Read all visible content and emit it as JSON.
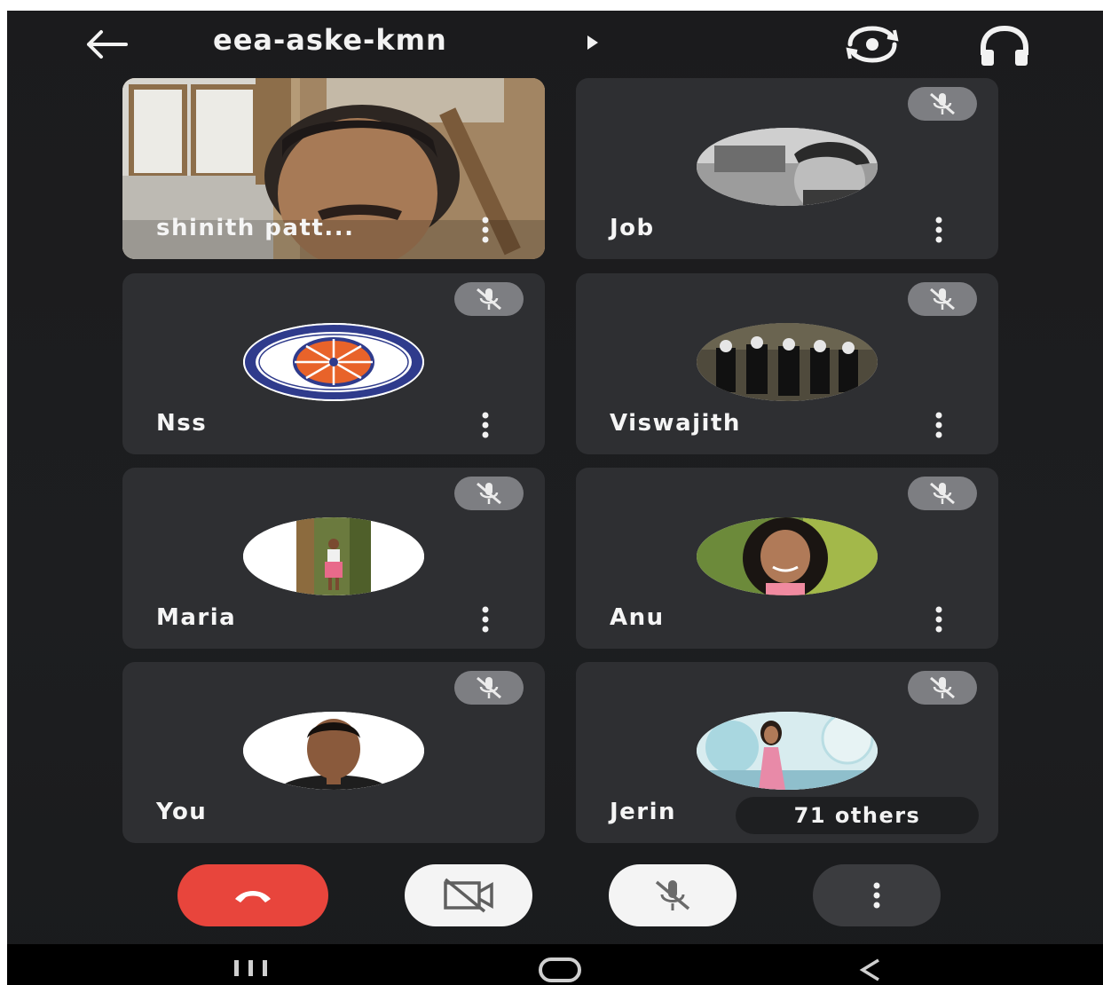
{
  "header": {
    "title": "eea-aske-kmn",
    "back_icon": "arrow-left-icon",
    "chevron_icon": "play-arrow-icon",
    "switch_camera_icon": "switch-camera-icon",
    "audio_output_icon": "headphones-icon"
  },
  "participants": [
    {
      "name": "shinith patt...",
      "video_on": true,
      "muted": false
    },
    {
      "name": "Job",
      "video_on": false,
      "muted": true
    },
    {
      "name": "Nss",
      "video_on": false,
      "muted": true
    },
    {
      "name": "Viswajith",
      "video_on": false,
      "muted": true
    },
    {
      "name": "Maria",
      "video_on": false,
      "muted": true
    },
    {
      "name": "Anu",
      "video_on": false,
      "muted": true
    },
    {
      "name": "You",
      "video_on": false,
      "muted": true
    },
    {
      "name": "Jerin",
      "video_on": false,
      "muted": true
    }
  ],
  "others_chip": "71 others",
  "controls": {
    "end_call_icon": "phone-hangup-icon",
    "camera_icon": "camera-off-icon",
    "mic_icon": "mic-off-icon",
    "more_icon": "more-vertical-icon"
  },
  "colors": {
    "background": "#1c1d1f",
    "tile": "#2e2f32",
    "end_call": "#e8453c",
    "badge": "#7d7e82"
  }
}
